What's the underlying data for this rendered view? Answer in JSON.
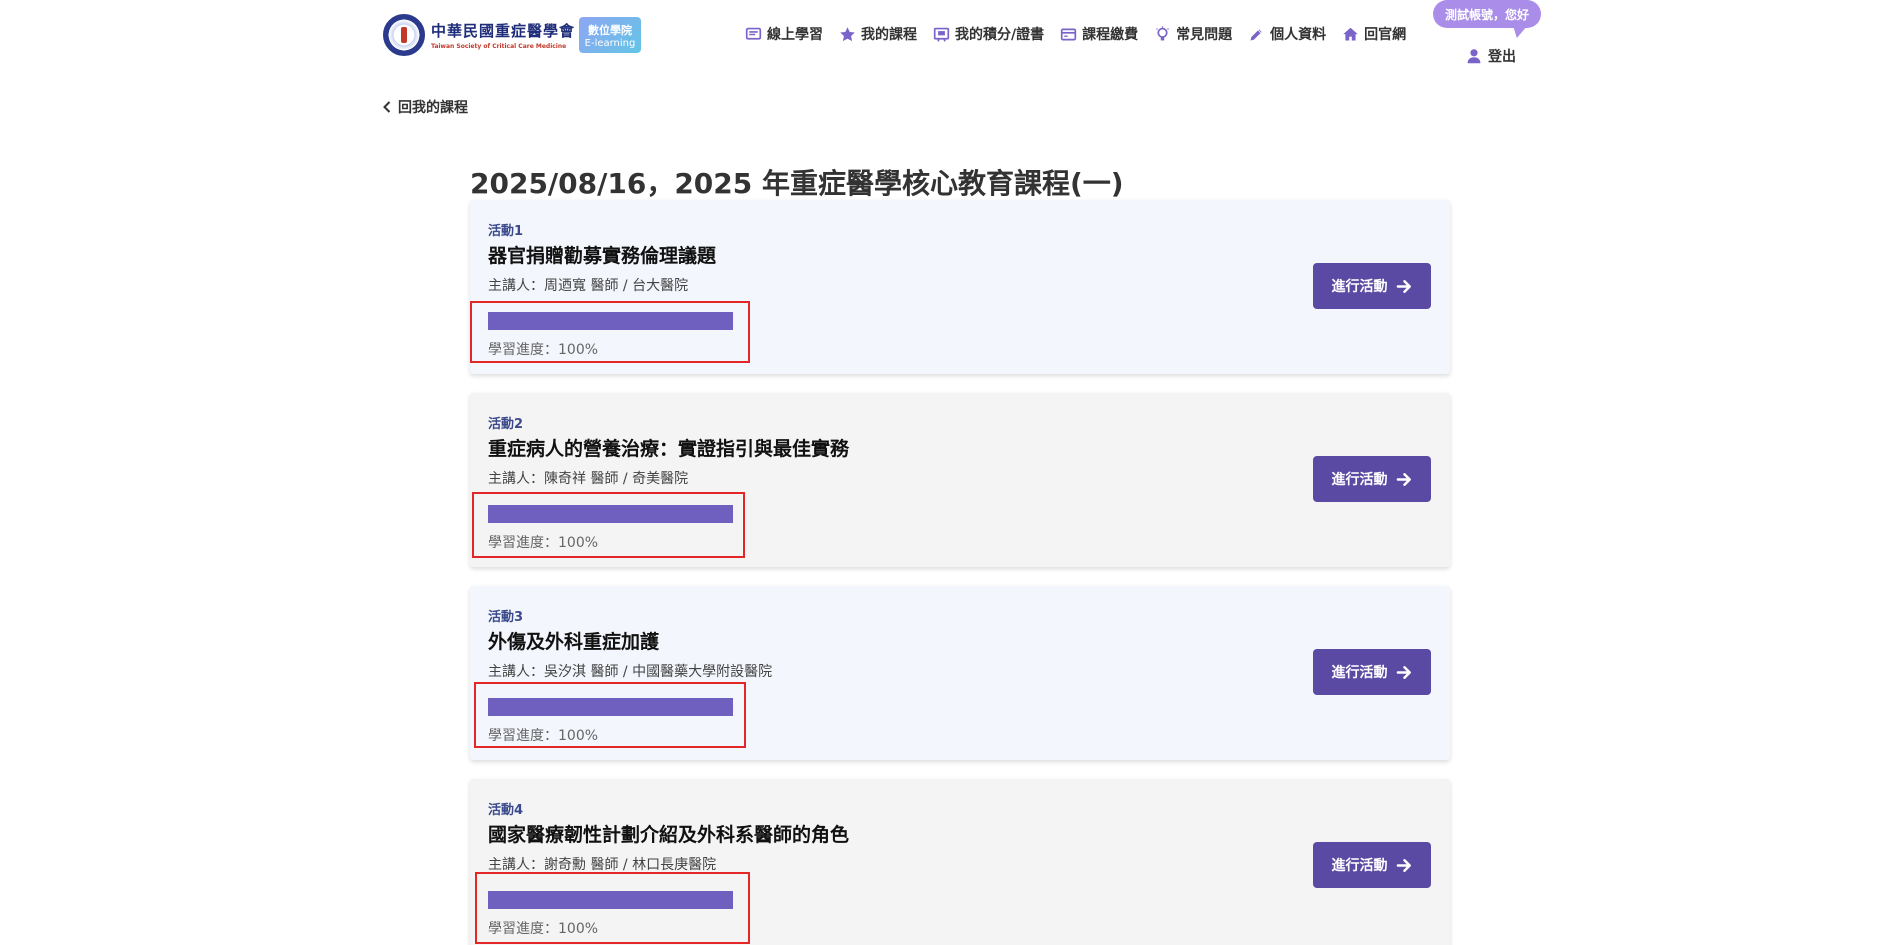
{
  "header": {
    "logo_cn": "中華民國重症醫學會",
    "logo_en": "Taiwan Society of Critical Care Medicine",
    "badge_line1": "數位學院",
    "badge_line2": "E-learning",
    "nav": [
      {
        "label": "線上學習",
        "icon": "online-learning-icon"
      },
      {
        "label": "我的課程",
        "icon": "star-icon"
      },
      {
        "label": "我的積分/證書",
        "icon": "certificate-icon"
      },
      {
        "label": "課程繳費",
        "icon": "credit-card-icon"
      },
      {
        "label": "常見問題",
        "icon": "lightbulb-icon"
      },
      {
        "label": "個人資料",
        "icon": "pencil-icon"
      },
      {
        "label": "回官網",
        "icon": "home-icon"
      }
    ],
    "greeting": "測試帳號，您好",
    "logout": "登出"
  },
  "back_link": "回我的課程",
  "page_title": "2025/08/16，2025 年重症醫學核心教育課程(一)",
  "activities": [
    {
      "no": "活動1",
      "title": "器官捐贈勸募實務倫理議題",
      "speaker": "主講人：周迺寬 醫師 / 台大醫院",
      "progress_label": "學習進度：100%",
      "progress": 1.0,
      "button": "進行活動"
    },
    {
      "no": "活動2",
      "title": "重症病人的營養治療：實證指引與最佳實務",
      "speaker": "主講人：陳奇祥 醫師 / 奇美醫院",
      "progress_label": "學習進度：100%",
      "progress": 1.0,
      "button": "進行活動"
    },
    {
      "no": "活動3",
      "title": "外傷及外科重症加護",
      "speaker": "主講人：吳汐淇 醫師 / 中國醫藥大學附設醫院",
      "progress_label": "學習進度：100%",
      "progress": 1.0,
      "button": "進行活動"
    },
    {
      "no": "活動4",
      "title": "國家醫療韌性計劃介紹及外科系醫師的角色",
      "speaker": "主講人：謝奇勳 醫師 / 林口長庚醫院",
      "progress_label": "學習進度：100%",
      "progress": 1.0,
      "button": "進行活動"
    }
  ],
  "colors": {
    "accent": "#5a4aa3",
    "bar": "#6f5fbf",
    "highlight": "#e32626",
    "bubble": "#a98de8"
  }
}
